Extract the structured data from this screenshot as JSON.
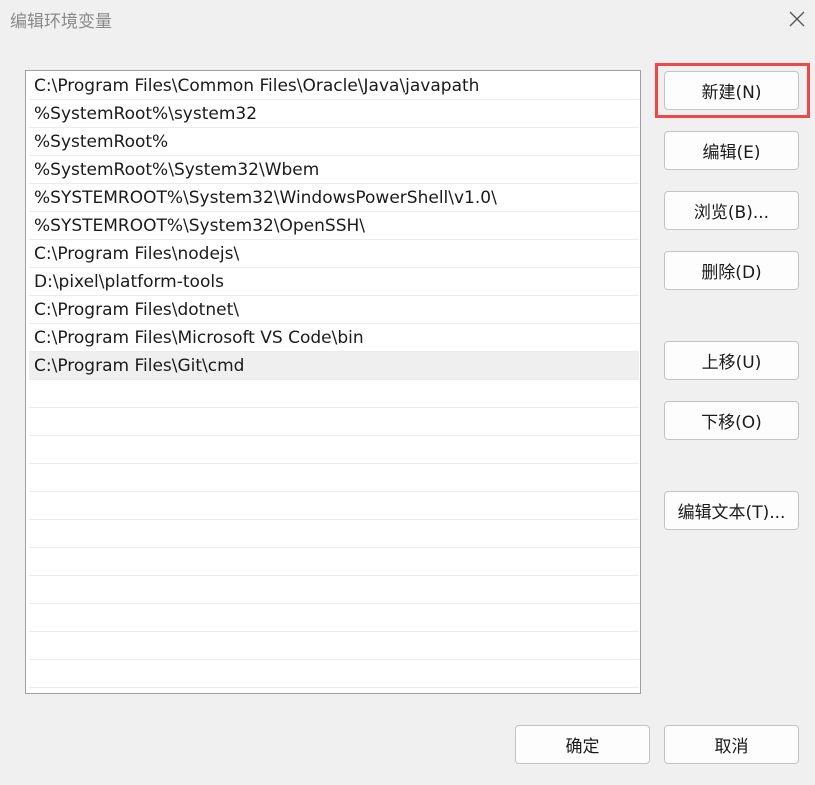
{
  "window": {
    "title": "编辑环境变量"
  },
  "path_list": [
    "C:\\Program Files\\Common Files\\Oracle\\Java\\javapath",
    "%SystemRoot%\\system32",
    "%SystemRoot%",
    "%SystemRoot%\\System32\\Wbem",
    "%SYSTEMROOT%\\System32\\WindowsPowerShell\\v1.0\\",
    "%SYSTEMROOT%\\System32\\OpenSSH\\",
    "C:\\Program Files\\nodejs\\",
    "D:\\pixel\\platform-tools",
    "C:\\Program Files\\dotnet\\",
    "C:\\Program Files\\Microsoft VS Code\\bin",
    "C:\\Program Files\\Git\\cmd"
  ],
  "selected_index": 10,
  "buttons": {
    "new": "新建(N)",
    "edit": "编辑(E)",
    "browse": "浏览(B)...",
    "delete": "删除(D)",
    "move_up": "上移(U)",
    "move_down": "下移(O)",
    "edit_text": "编辑文本(T)...",
    "ok": "确定",
    "cancel": "取消"
  },
  "colors": {
    "highlight": "#f04848"
  }
}
